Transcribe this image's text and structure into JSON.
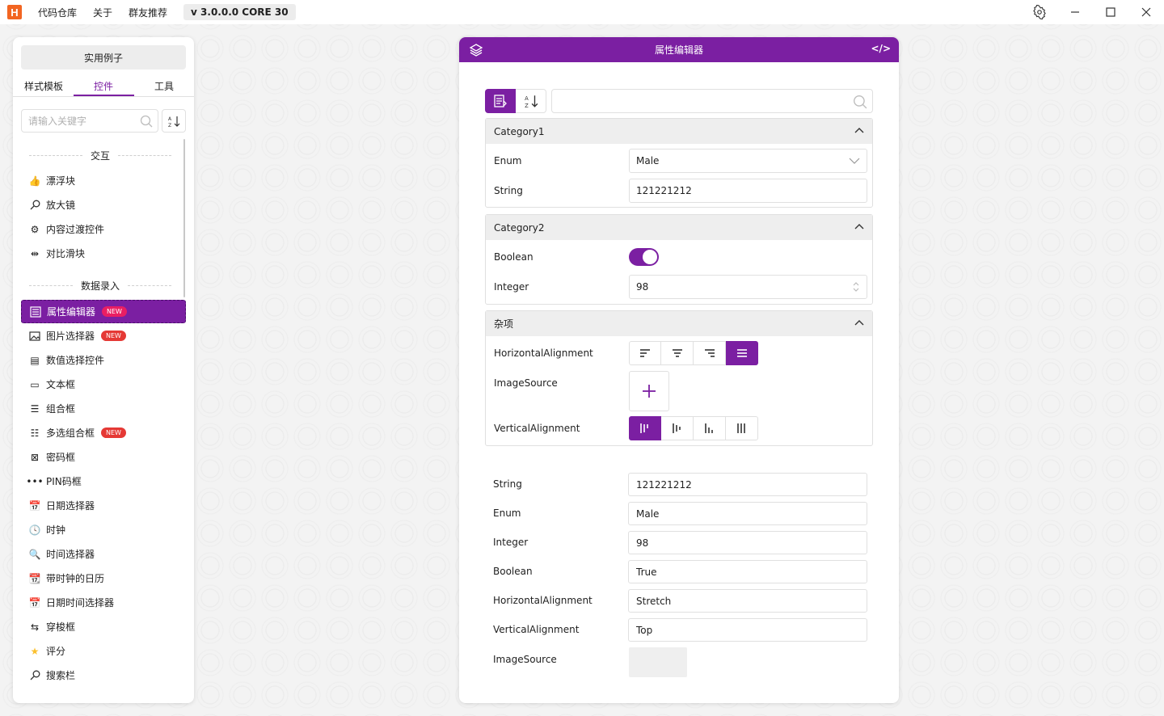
{
  "titlebar": {
    "logo": "H",
    "menu": [
      "代码仓库",
      "关于",
      "群友推荐"
    ],
    "version": "v 3.0.0.0 CORE 30"
  },
  "left": {
    "example_button": "实用例子",
    "tabs": [
      "样式模板",
      "控件",
      "工具"
    ],
    "active_tab": 1,
    "search_placeholder": "请输入关键字",
    "groups": [
      {
        "title": "交互",
        "items": [
          "漂浮块",
          "放大镜",
          "内容过渡控件",
          "对比滑块"
        ]
      },
      {
        "title": "数据录入",
        "items": [
          "属性编辑器",
          "图片选择器",
          "数值选择控件",
          "文本框",
          "组合框",
          "多选组合框",
          "密码框",
          "PIN码框",
          "日期选择器",
          "时钟",
          "时间选择器",
          "带时钟的日历",
          "日期时间选择器",
          "穿梭框",
          "评分",
          "搜索栏"
        ]
      }
    ],
    "badge": "NEW",
    "selected_item": "属性编辑器"
  },
  "panel": {
    "title": "属性编辑器",
    "code_icon": "</>",
    "categories": [
      {
        "name": "Category1",
        "props": [
          {
            "label": "Enum",
            "value": "Male",
            "kind": "combo"
          },
          {
            "label": "String",
            "value": "121221212",
            "kind": "text"
          }
        ]
      },
      {
        "name": "Category2",
        "props": [
          {
            "label": "Boolean",
            "value": "True",
            "kind": "toggle"
          },
          {
            "label": "Integer",
            "value": "98",
            "kind": "numeric"
          }
        ]
      },
      {
        "name": "杂项",
        "props": [
          {
            "label": "HorizontalAlignment",
            "kind": "segmented",
            "selected": 3
          },
          {
            "label": "ImageSource",
            "kind": "image"
          },
          {
            "label": "VerticalAlignment",
            "kind": "segmented",
            "selected": 0
          }
        ]
      }
    ],
    "output": [
      {
        "label": "String",
        "value": "121221212"
      },
      {
        "label": "Enum",
        "value": "Male"
      },
      {
        "label": "Integer",
        "value": "98"
      },
      {
        "label": "Boolean",
        "value": "True"
      },
      {
        "label": "HorizontalAlignment",
        "value": "Stretch"
      },
      {
        "label": "VerticalAlignment",
        "value": "Top"
      },
      {
        "label": "ImageSource",
        "value": ""
      }
    ]
  },
  "colors": {
    "accent": "#7b1fa2",
    "badge": "#e53935"
  }
}
